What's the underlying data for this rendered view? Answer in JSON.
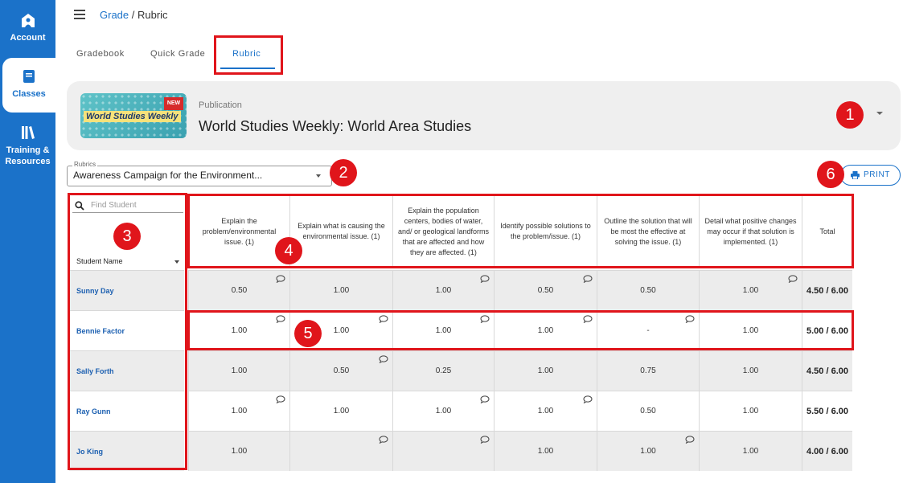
{
  "sidebar": {
    "items": [
      {
        "label": "Account",
        "icon": "account-icon"
      },
      {
        "label": "Classes",
        "icon": "book-icon"
      },
      {
        "label": "Training & Resources",
        "icon": "library-icon"
      }
    ]
  },
  "breadcrumb": {
    "parent": "Grade",
    "separator": " / ",
    "current": "Rubric"
  },
  "tabs": [
    "Gradebook",
    "Quick Grade",
    "Rubric"
  ],
  "publication": {
    "label": "Publication",
    "title": "World Studies Weekly: World Area Studies",
    "thumbnail": {
      "badge": "NEW",
      "logo": "World Studies Weekly"
    }
  },
  "rubric_select": {
    "legend": "Rubrics",
    "value": "Awareness Campaign for the Environment..."
  },
  "print_label": "PRINT",
  "search_placeholder": "Find Student",
  "student_column_label": "Student Name",
  "criteria": [
    "Explain the problem/environmental issue. (1)",
    "Explain what is causing the environmental issue. (1)",
    "Explain the population centers, bodies of water, and/ or geological landforms that are affected and how they are affected. (1)",
    "Identify possible solutions to the problem/issue. (1)",
    "Outline the solution that will be most the effective at solving the issue. (1)",
    "Detail what positive changes may occur if that solution is implemented. (1)",
    "Total"
  ],
  "rows": [
    {
      "student": "Sunny Day",
      "scores": [
        "0.50",
        "1.00",
        "1.00",
        "0.50",
        "0.50",
        "1.00"
      ],
      "comments": [
        true,
        false,
        true,
        true,
        false,
        true
      ],
      "total": "4.50 / 6.00"
    },
    {
      "student": "Bennie Factor",
      "scores": [
        "1.00",
        "1.00",
        "1.00",
        "1.00",
        "-",
        "1.00"
      ],
      "comments": [
        true,
        true,
        true,
        true,
        true,
        false
      ],
      "total": "5.00 / 6.00"
    },
    {
      "student": "Sally Forth",
      "scores": [
        "1.00",
        "0.50",
        "0.25",
        "1.00",
        "0.75",
        "1.00"
      ],
      "comments": [
        false,
        true,
        false,
        false,
        false,
        false
      ],
      "total": "4.50 / 6.00"
    },
    {
      "student": "Ray Gunn",
      "scores": [
        "1.00",
        "1.00",
        "1.00",
        "1.00",
        "0.50",
        "1.00"
      ],
      "comments": [
        true,
        false,
        true,
        true,
        false,
        false
      ],
      "total": "5.50 / 6.00"
    },
    {
      "student": "Jo King",
      "scores": [
        "1.00",
        "",
        "",
        "1.00",
        "1.00",
        "1.00"
      ],
      "comments": [
        false,
        true,
        true,
        false,
        true,
        false
      ],
      "total": "4.00 / 6.00"
    }
  ],
  "annotations": [
    "1",
    "2",
    "3",
    "4",
    "5",
    "6"
  ],
  "colors": {
    "accent": "#1b72c9",
    "annotation": "#e0151b",
    "row_alt": "#ececec"
  }
}
